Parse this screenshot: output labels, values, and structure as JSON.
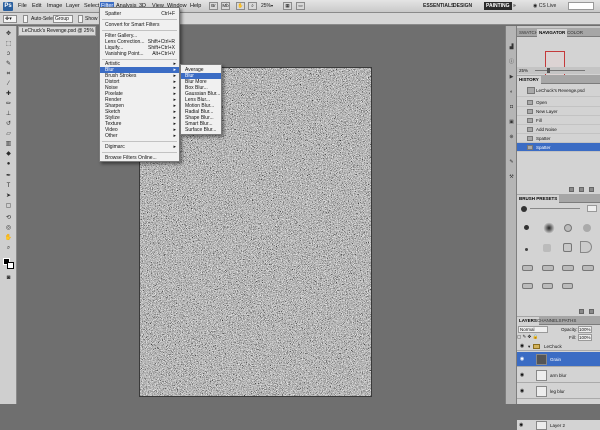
{
  "menubar": {
    "items": [
      "File",
      "Edit",
      "Image",
      "Layer",
      "Select",
      "Filter",
      "Analysis",
      "3D",
      "View",
      "Window",
      "Help"
    ],
    "zoom": "25%",
    "workspaces": [
      "ESSENTIALS",
      "DESIGN",
      "PAINTING"
    ],
    "cs_live": "CS Live"
  },
  "options": {
    "auto_select_label": "Auto-Select:",
    "auto_select_value": "Group",
    "show_label": "Show T"
  },
  "document": {
    "tab_title": "LeChuck's Revenge.psd @ 25% (Gra"
  },
  "filter_menu": {
    "items": [
      {
        "label": "Spatter",
        "shortcut": "Ctrl+F"
      },
      {
        "label": "Convert for Smart Filters"
      },
      {
        "label": "Filter Gallery..."
      },
      {
        "label": "Lens Correction...",
        "shortcut": "Shift+Ctrl+R"
      },
      {
        "label": "Liquify...",
        "shortcut": "Shift+Ctrl+X"
      },
      {
        "label": "Vanishing Point...",
        "shortcut": "Alt+Ctrl+V"
      },
      {
        "label": "Artistic"
      },
      {
        "label": "Blur"
      },
      {
        "label": "Brush Strokes"
      },
      {
        "label": "Distort"
      },
      {
        "label": "Noise"
      },
      {
        "label": "Pixelate"
      },
      {
        "label": "Render"
      },
      {
        "label": "Sharpen"
      },
      {
        "label": "Sketch"
      },
      {
        "label": "Stylize"
      },
      {
        "label": "Texture"
      },
      {
        "label": "Video"
      },
      {
        "label": "Other"
      },
      {
        "label": "Digimarc"
      },
      {
        "label": "Browse Filters Online..."
      }
    ]
  },
  "blur_submenu": {
    "items": [
      "Average",
      "Blur",
      "Blur More",
      "Box Blur...",
      "Gaussian Blur...",
      "Lens Blur...",
      "Motion Blur...",
      "Radial Blur...",
      "Shape Blur...",
      "Smart Blur...",
      "Surface Blur..."
    ]
  },
  "panels": {
    "nav_tabs": [
      "SWATCH",
      "NAVIGATOR",
      "COLOR"
    ],
    "nav_zoom": "25%",
    "history_tab": "HISTORY",
    "history_snapshot": "LeChuck's Revenge.psd",
    "history_items": [
      "Open",
      "New Layer",
      "Fill",
      "Add Noise",
      "Spatter",
      "Spatter"
    ],
    "brush_tab": "BRUSH PRESETS",
    "layers_tabs": [
      "LAYERS",
      "CHANNELS",
      "PATHS"
    ],
    "blend_mode": "Normal",
    "opacity_label": "Opacity:",
    "opacity_value": "100%",
    "fill_label": "Fill:",
    "fill_value": "100%",
    "layers": [
      "LeChuck",
      "Grain",
      "arm blur",
      "leg blur",
      "Layer 2"
    ]
  }
}
